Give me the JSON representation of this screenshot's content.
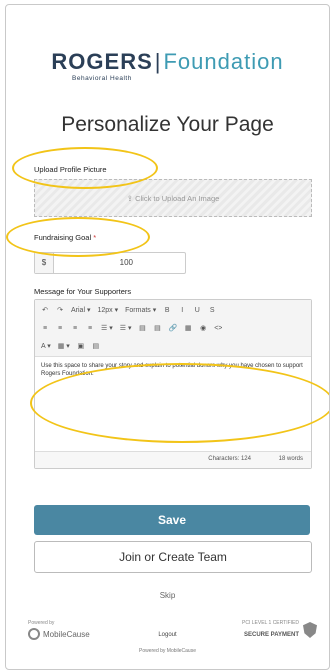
{
  "brand": {
    "name": "ROGERS",
    "separator": "|",
    "suffix": "Foundation",
    "sub": "Behavioral Health"
  },
  "page_title": "Personalize Your Page",
  "upload": {
    "label": "Upload Profile Picture",
    "placeholder": "Click to Upload An Image"
  },
  "goal": {
    "label": "Fundraising Goal",
    "required": "*",
    "currency": "$",
    "value": "100"
  },
  "message": {
    "label": "Message for Your Supporters",
    "toolbar_row1": [
      "↶",
      "↷",
      "Arial ▾",
      "12px ▾",
      "Formats ▾",
      "B",
      "I",
      "U",
      "S"
    ],
    "toolbar_row2": [
      "≡",
      "≡",
      "≡",
      "≡",
      "☰ ▾",
      "☰ ▾",
      "▤",
      "▤",
      "🔗",
      "▦",
      "◉",
      "<>"
    ],
    "toolbar_row3": [
      "A ▾",
      "▦ ▾",
      "▣",
      "▤"
    ],
    "content": "Use this space to share your story and explain to potential donors why you have chosen to support Rogers Foundation.",
    "characters": "Characters: 124",
    "words": "18 words"
  },
  "buttons": {
    "save": "Save",
    "team": "Join or Create Team",
    "skip": "Skip"
  },
  "footer": {
    "powered_small": "Powered by",
    "mc": "MobileCause",
    "logout": "Logout",
    "powered": "Powered by MobileCause",
    "secure_small": "PCI LEVEL 1 CERTIFIED",
    "secure": "SECURE PAYMENT"
  }
}
